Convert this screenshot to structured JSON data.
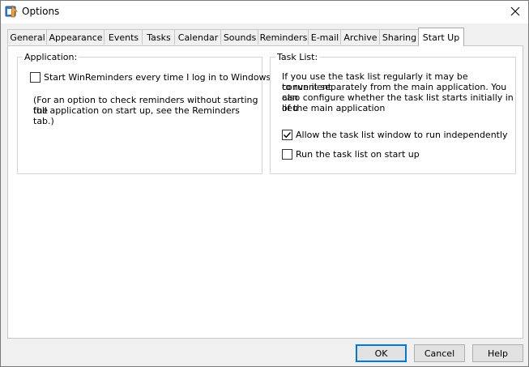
{
  "window": {
    "title": "Options"
  },
  "tabs": [
    {
      "label": "General"
    },
    {
      "label": "Appearance"
    },
    {
      "label": "Events"
    },
    {
      "label": "Tasks"
    },
    {
      "label": "Calendar"
    },
    {
      "label": "Sounds"
    },
    {
      "label": "Reminders"
    },
    {
      "label": "E-mail"
    },
    {
      "label": "Archive"
    },
    {
      "label": "Sharing"
    },
    {
      "label": "Start Up",
      "active": true
    }
  ],
  "application_group": {
    "legend": "Application:",
    "start_checkbox": {
      "label": "Start WinReminders every time I log in to Windows",
      "checked": false
    },
    "note_line1": "(For an option to check reminders without starting the",
    "note_line2": "full application on start up, see the Reminders tab.)"
  },
  "tasklist_group": {
    "legend": "Task List:",
    "desc_line1": "If you use the task list regularly it may be convenient",
    "desc_line2": "to run it separately from the main application. You can",
    "desc_line3": "also configure whether the task list starts initially in lieu",
    "desc_line4": "of the main application",
    "independent_checkbox": {
      "label": "Allow the task list window to run independently",
      "checked": true
    },
    "startup_checkbox": {
      "label": "Run the task list on start up",
      "checked": false
    }
  },
  "buttons": {
    "ok": "OK",
    "cancel": "Cancel",
    "help": "Help"
  },
  "colors": {
    "accent": "#0078d7",
    "window_bg": "#f0f0f0",
    "panel_bg": "#ffffff"
  }
}
